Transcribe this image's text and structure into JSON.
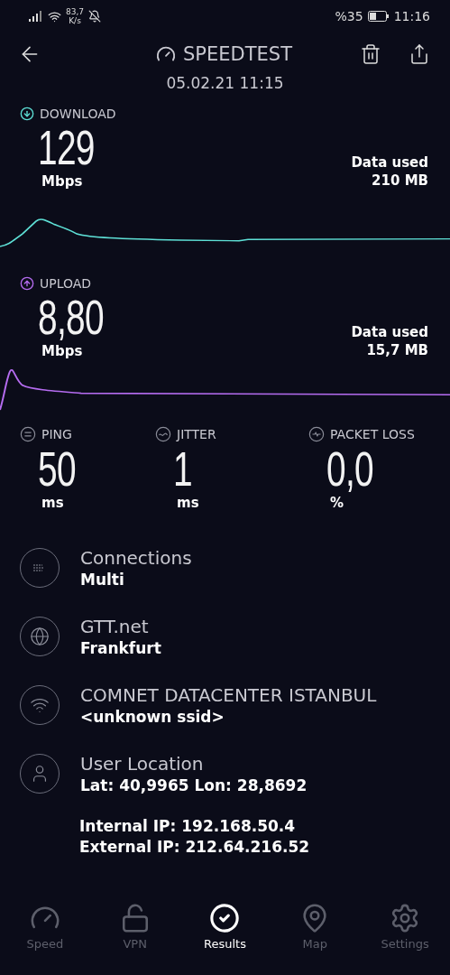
{
  "status_bar": {
    "net_speed": "83,7",
    "net_unit": "K/s",
    "battery": "%35",
    "time": "11:16"
  },
  "header": {
    "title": "SPEEDTEST",
    "date": "05.02.21 11:15"
  },
  "results": [
    {
      "kind": "download",
      "label": "DOWNLOAD",
      "value": "129",
      "unit": "Mbps",
      "data_label": "Data used",
      "data_value": "210 MB",
      "color": "#5ee0d6"
    },
    {
      "kind": "upload",
      "label": "UPLOAD",
      "value": "8,80",
      "unit": "Mbps",
      "data_label": "Data used",
      "data_value": "15,7 MB",
      "color": "#b56cf0"
    }
  ],
  "metrics": [
    {
      "kind": "ping",
      "label": "PING",
      "value": "50",
      "unit": "ms"
    },
    {
      "kind": "jitter",
      "label": "JITTER",
      "value": "1",
      "unit": "ms"
    },
    {
      "kind": "loss",
      "label": "PACKET LOSS",
      "value": "0,0",
      "unit": "%"
    }
  ],
  "info": [
    {
      "kind": "connections",
      "title": "Connections",
      "detail": "Multi"
    },
    {
      "kind": "server",
      "title": "GTT.net",
      "detail": "Frankfurt"
    },
    {
      "kind": "network",
      "title": "COMNET DATACENTER ISTANBUL",
      "detail": "<unknown ssid>"
    },
    {
      "kind": "location",
      "title": "User Location",
      "detail": "Lat: 40,9965 Lon: 28,8692"
    }
  ],
  "ip_lines": [
    "Internal IP: 192.168.50.4",
    "External IP: 212.64.216.52"
  ],
  "tabs": [
    {
      "kind": "speed",
      "label": "Speed",
      "selected": false
    },
    {
      "kind": "vpn",
      "label": "VPN",
      "selected": false
    },
    {
      "kind": "results",
      "label": "Results",
      "selected": true
    },
    {
      "kind": "map",
      "label": "Map",
      "selected": false
    },
    {
      "kind": "settings",
      "label": "Settings",
      "selected": false
    }
  ]
}
